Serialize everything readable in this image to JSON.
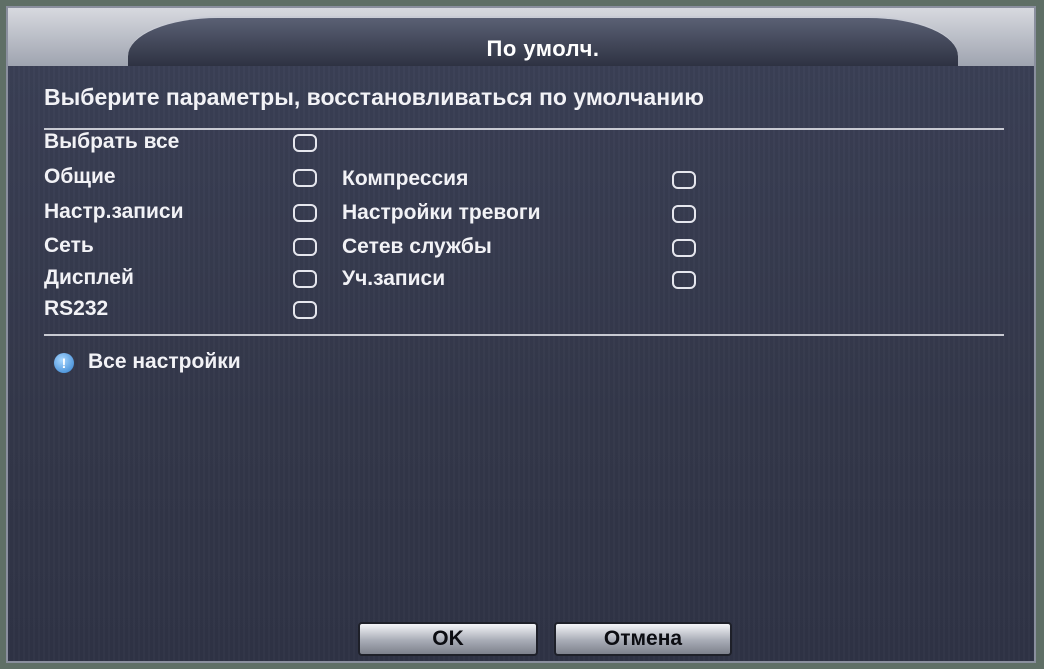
{
  "window": {
    "title": "По умолч.",
    "subtitle": "Выберите параметры, восстановливаться по умолчанию"
  },
  "options": {
    "select_all": "Выбрать все",
    "general": "Общие",
    "compression": "Компрессия",
    "record_settings": "Настр.записи",
    "alarm_settings": "Настройки тревоги",
    "network": "Сеть",
    "net_services": "Сетев службы",
    "display": "Дисплей",
    "accounts": "Уч.записи",
    "rs232": "RS232"
  },
  "info": {
    "text": "Все настройки",
    "icon": "info-icon"
  },
  "buttons": {
    "ok": "OK",
    "cancel": "Отмена"
  },
  "colors": {
    "panel": "#3a3f52",
    "text": "#f2f2f6",
    "info_icon": "#2f7fd0"
  }
}
